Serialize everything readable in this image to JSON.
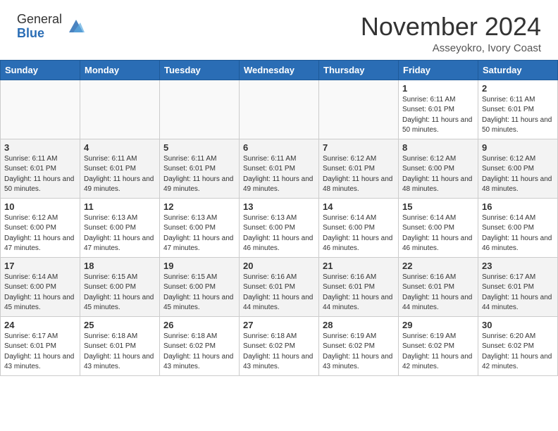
{
  "header": {
    "logo_general": "General",
    "logo_blue": "Blue",
    "month_title": "November 2024",
    "subtitle": "Asseyokro, Ivory Coast"
  },
  "weekdays": [
    "Sunday",
    "Monday",
    "Tuesday",
    "Wednesday",
    "Thursday",
    "Friday",
    "Saturday"
  ],
  "weeks": [
    [
      {
        "day": "",
        "sunrise": "",
        "sunset": "",
        "daylight": ""
      },
      {
        "day": "",
        "sunrise": "",
        "sunset": "",
        "daylight": ""
      },
      {
        "day": "",
        "sunrise": "",
        "sunset": "",
        "daylight": ""
      },
      {
        "day": "",
        "sunrise": "",
        "sunset": "",
        "daylight": ""
      },
      {
        "day": "",
        "sunrise": "",
        "sunset": "",
        "daylight": ""
      },
      {
        "day": "1",
        "sunrise": "Sunrise: 6:11 AM",
        "sunset": "Sunset: 6:01 PM",
        "daylight": "Daylight: 11 hours and 50 minutes."
      },
      {
        "day": "2",
        "sunrise": "Sunrise: 6:11 AM",
        "sunset": "Sunset: 6:01 PM",
        "daylight": "Daylight: 11 hours and 50 minutes."
      }
    ],
    [
      {
        "day": "3",
        "sunrise": "Sunrise: 6:11 AM",
        "sunset": "Sunset: 6:01 PM",
        "daylight": "Daylight: 11 hours and 50 minutes."
      },
      {
        "day": "4",
        "sunrise": "Sunrise: 6:11 AM",
        "sunset": "Sunset: 6:01 PM",
        "daylight": "Daylight: 11 hours and 49 minutes."
      },
      {
        "day": "5",
        "sunrise": "Sunrise: 6:11 AM",
        "sunset": "Sunset: 6:01 PM",
        "daylight": "Daylight: 11 hours and 49 minutes."
      },
      {
        "day": "6",
        "sunrise": "Sunrise: 6:11 AM",
        "sunset": "Sunset: 6:01 PM",
        "daylight": "Daylight: 11 hours and 49 minutes."
      },
      {
        "day": "7",
        "sunrise": "Sunrise: 6:12 AM",
        "sunset": "Sunset: 6:01 PM",
        "daylight": "Daylight: 11 hours and 48 minutes."
      },
      {
        "day": "8",
        "sunrise": "Sunrise: 6:12 AM",
        "sunset": "Sunset: 6:00 PM",
        "daylight": "Daylight: 11 hours and 48 minutes."
      },
      {
        "day": "9",
        "sunrise": "Sunrise: 6:12 AM",
        "sunset": "Sunset: 6:00 PM",
        "daylight": "Daylight: 11 hours and 48 minutes."
      }
    ],
    [
      {
        "day": "10",
        "sunrise": "Sunrise: 6:12 AM",
        "sunset": "Sunset: 6:00 PM",
        "daylight": "Daylight: 11 hours and 47 minutes."
      },
      {
        "day": "11",
        "sunrise": "Sunrise: 6:13 AM",
        "sunset": "Sunset: 6:00 PM",
        "daylight": "Daylight: 11 hours and 47 minutes."
      },
      {
        "day": "12",
        "sunrise": "Sunrise: 6:13 AM",
        "sunset": "Sunset: 6:00 PM",
        "daylight": "Daylight: 11 hours and 47 minutes."
      },
      {
        "day": "13",
        "sunrise": "Sunrise: 6:13 AM",
        "sunset": "Sunset: 6:00 PM",
        "daylight": "Daylight: 11 hours and 46 minutes."
      },
      {
        "day": "14",
        "sunrise": "Sunrise: 6:14 AM",
        "sunset": "Sunset: 6:00 PM",
        "daylight": "Daylight: 11 hours and 46 minutes."
      },
      {
        "day": "15",
        "sunrise": "Sunrise: 6:14 AM",
        "sunset": "Sunset: 6:00 PM",
        "daylight": "Daylight: 11 hours and 46 minutes."
      },
      {
        "day": "16",
        "sunrise": "Sunrise: 6:14 AM",
        "sunset": "Sunset: 6:00 PM",
        "daylight": "Daylight: 11 hours and 46 minutes."
      }
    ],
    [
      {
        "day": "17",
        "sunrise": "Sunrise: 6:14 AM",
        "sunset": "Sunset: 6:00 PM",
        "daylight": "Daylight: 11 hours and 45 minutes."
      },
      {
        "day": "18",
        "sunrise": "Sunrise: 6:15 AM",
        "sunset": "Sunset: 6:00 PM",
        "daylight": "Daylight: 11 hours and 45 minutes."
      },
      {
        "day": "19",
        "sunrise": "Sunrise: 6:15 AM",
        "sunset": "Sunset: 6:00 PM",
        "daylight": "Daylight: 11 hours and 45 minutes."
      },
      {
        "day": "20",
        "sunrise": "Sunrise: 6:16 AM",
        "sunset": "Sunset: 6:01 PM",
        "daylight": "Daylight: 11 hours and 44 minutes."
      },
      {
        "day": "21",
        "sunrise": "Sunrise: 6:16 AM",
        "sunset": "Sunset: 6:01 PM",
        "daylight": "Daylight: 11 hours and 44 minutes."
      },
      {
        "day": "22",
        "sunrise": "Sunrise: 6:16 AM",
        "sunset": "Sunset: 6:01 PM",
        "daylight": "Daylight: 11 hours and 44 minutes."
      },
      {
        "day": "23",
        "sunrise": "Sunrise: 6:17 AM",
        "sunset": "Sunset: 6:01 PM",
        "daylight": "Daylight: 11 hours and 44 minutes."
      }
    ],
    [
      {
        "day": "24",
        "sunrise": "Sunrise: 6:17 AM",
        "sunset": "Sunset: 6:01 PM",
        "daylight": "Daylight: 11 hours and 43 minutes."
      },
      {
        "day": "25",
        "sunrise": "Sunrise: 6:18 AM",
        "sunset": "Sunset: 6:01 PM",
        "daylight": "Daylight: 11 hours and 43 minutes."
      },
      {
        "day": "26",
        "sunrise": "Sunrise: 6:18 AM",
        "sunset": "Sunset: 6:02 PM",
        "daylight": "Daylight: 11 hours and 43 minutes."
      },
      {
        "day": "27",
        "sunrise": "Sunrise: 6:18 AM",
        "sunset": "Sunset: 6:02 PM",
        "daylight": "Daylight: 11 hours and 43 minutes."
      },
      {
        "day": "28",
        "sunrise": "Sunrise: 6:19 AM",
        "sunset": "Sunset: 6:02 PM",
        "daylight": "Daylight: 11 hours and 43 minutes."
      },
      {
        "day": "29",
        "sunrise": "Sunrise: 6:19 AM",
        "sunset": "Sunset: 6:02 PM",
        "daylight": "Daylight: 11 hours and 42 minutes."
      },
      {
        "day": "30",
        "sunrise": "Sunrise: 6:20 AM",
        "sunset": "Sunset: 6:02 PM",
        "daylight": "Daylight: 11 hours and 42 minutes."
      }
    ]
  ]
}
